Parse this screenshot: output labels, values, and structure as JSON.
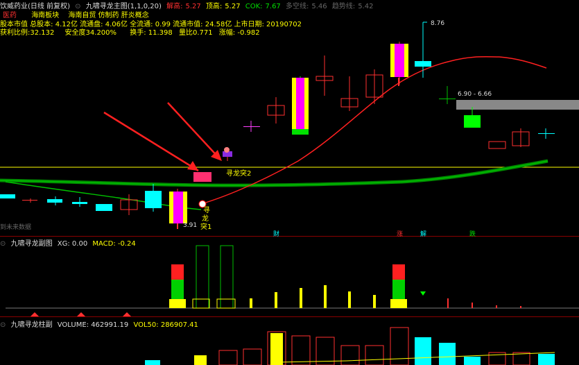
{
  "header": {
    "title": "饮威药业(日线 前复权)",
    "indicator": "九啸寻龙主图(1,1,0,20)",
    "bottom_label": "解高:",
    "bottom_value": "5.27",
    "top_label": "顶高:",
    "top_value": "5.27",
    "cok_label": "COK:",
    "cok_value": "7.67",
    "multi_label": "多空线:",
    "multi_value": "5.46",
    "trend_label": "趋势线:",
    "trend_value": "5.42"
  },
  "row2": {
    "industry": "医药",
    "sector": "海南板块",
    "concepts": "海南自贸 仿制药 肝炎概念"
  },
  "row3": {
    "text": "股本市值 总股本: 4.12亿 流通盘: 4.06亿 全流通: 0.99 流通市值: 24.58亿 上市日期: 20190702"
  },
  "row4": {
    "profit": "获利比例:32.132",
    "safety": "安全度34.200%",
    "turnover": "换手: 11.398",
    "vol_ratio": "量比0.771",
    "change": "涨幅: -0.982"
  },
  "price_labels": {
    "high": "8.76",
    "low": "3.91",
    "range": "6.90 - 6.66"
  },
  "annotations": {
    "xl2": "寻龙突2",
    "xl1_a": "寻",
    "xl1_b": "龙",
    "xl1_c": "突1",
    "future": "到未来数据",
    "cai": "财",
    "zhang": "涨",
    "jie": "解",
    "die": "跌"
  },
  "sub1": {
    "title": "九啸寻龙副图",
    "xg": "XG: 0.00",
    "macd": "MACD: -0.24"
  },
  "sub2": {
    "title": "九啸寻龙柱副",
    "volume": "VOLUME: 462991.19",
    "vol50": "VOL50: 286907.41"
  },
  "colors": {
    "up": "#ff3030",
    "down": "#00ffff",
    "yellow": "#ffff00",
    "magenta": "#ff00ff",
    "green": "#00c000"
  }
}
